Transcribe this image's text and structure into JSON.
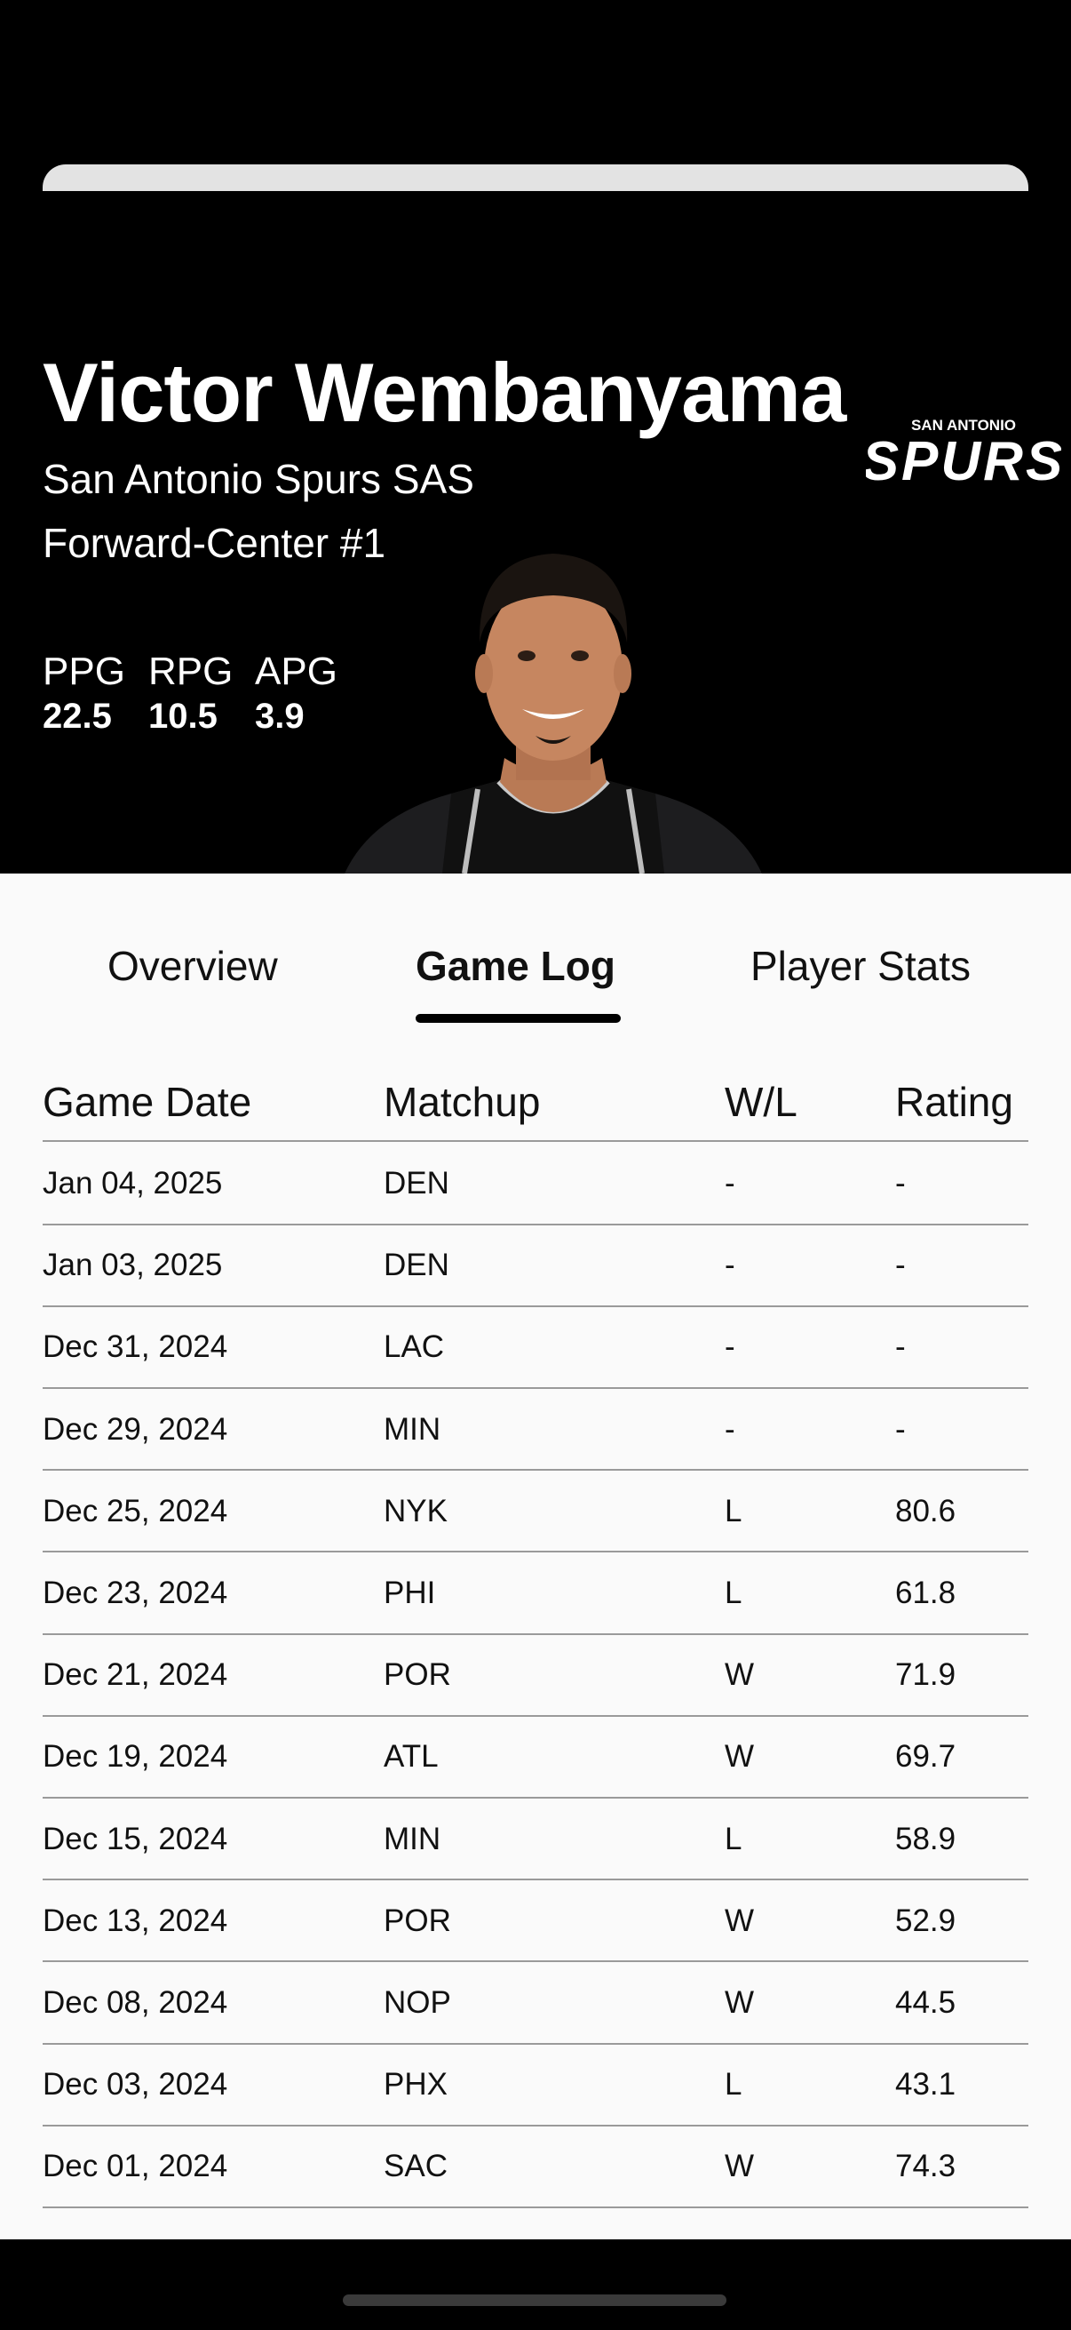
{
  "player": {
    "name": "Victor Wembanyama",
    "team": "San Antonio Spurs SAS",
    "position": "Forward-Center #1"
  },
  "stats": [
    {
      "label": "PPG",
      "value": "22.5"
    },
    {
      "label": "RPG",
      "value": "10.5"
    },
    {
      "label": "APG",
      "value": "3.9"
    }
  ],
  "logo": {
    "top_text": "SAN ANTONIO",
    "main_text": "SPURS"
  },
  "tabs": [
    {
      "label": "Overview",
      "active": false
    },
    {
      "label": "Game Log",
      "active": true
    },
    {
      "label": "Player Stats",
      "active": false
    }
  ],
  "table": {
    "headers": [
      "Game Date",
      "Matchup",
      "W/L",
      "Rating"
    ],
    "rows": [
      [
        "Jan 04, 2025",
        "DEN",
        "-",
        "-"
      ],
      [
        "Jan 03, 2025",
        "DEN",
        "-",
        "-"
      ],
      [
        "Dec 31, 2024",
        "LAC",
        "-",
        "-"
      ],
      [
        "Dec 29, 2024",
        "MIN",
        "-",
        "-"
      ],
      [
        "Dec 25, 2024",
        "NYK",
        "L",
        "80.6"
      ],
      [
        "Dec 23, 2024",
        "PHI",
        "L",
        "61.8"
      ],
      [
        "Dec 21, 2024",
        "POR",
        "W",
        "71.9"
      ],
      [
        "Dec 19, 2024",
        "ATL",
        "W",
        "69.7"
      ],
      [
        "Dec 15, 2024",
        "MIN",
        "L",
        "58.9"
      ],
      [
        "Dec 13, 2024",
        "POR",
        "W",
        "52.9"
      ],
      [
        "Dec 08, 2024",
        "NOP",
        "W",
        "44.5"
      ],
      [
        "Dec 03, 2024",
        "PHX",
        "L",
        "43.1"
      ],
      [
        "Dec 01, 2024",
        "SAC",
        "W",
        "74.3"
      ]
    ]
  },
  "colors": {
    "header_bg": "#000000",
    "content_bg": "#fafafa",
    "divider": "#9a9a9a"
  }
}
